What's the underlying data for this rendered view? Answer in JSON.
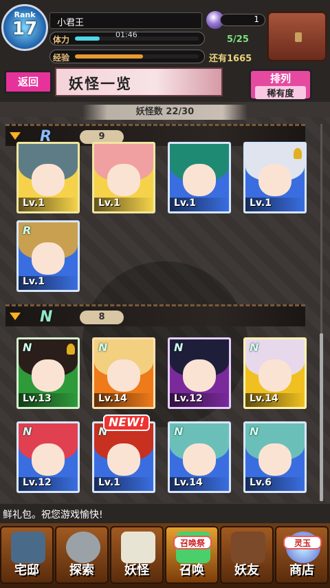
{
  "player": {
    "rank_label": "Rank",
    "rank": "17",
    "name": "小君王",
    "stamina_label": "体力",
    "timer": "01:46",
    "stamina": "5/25",
    "stamina_fill": 0.2,
    "exp_label": "经验",
    "exp_fill": 0.55,
    "coins_label": "还有1665",
    "orbs": "1"
  },
  "header": {
    "back_label": "返回",
    "title": "妖怪一览",
    "sort_line1": "排列",
    "sort_line2": "稀有度"
  },
  "count_label": "妖怪数  22/30",
  "sections": [
    {
      "rarity": "R",
      "count": "9"
    },
    {
      "rarity": "N",
      "count": "8"
    }
  ],
  "cards_r": [
    {
      "level": "Lv.1",
      "rk": ""
    },
    {
      "level": "Lv.1",
      "rk": ""
    },
    {
      "level": "Lv.1",
      "rk": ""
    },
    {
      "level": "Lv.1",
      "rk": ""
    },
    {
      "level": "Lv.1",
      "rk": "R"
    }
  ],
  "cards_n": [
    {
      "level": "Lv.13",
      "rk": "N"
    },
    {
      "level": "Lv.14",
      "rk": "N"
    },
    {
      "level": "Lv.12",
      "rk": "N"
    },
    {
      "level": "Lv.14",
      "rk": "N"
    },
    {
      "level": "Lv.12",
      "rk": "N"
    },
    {
      "level": "Lv.1",
      "rk": "N"
    },
    {
      "level": "Lv.14",
      "rk": "N"
    },
    {
      "level": "Lv.6",
      "rk": "N"
    }
  ],
  "new_badge": "NEW!",
  "ticker": "鲜礼包。祝您游戏愉快!",
  "nav": [
    {
      "label": "宅邸",
      "icon": "mansion-icon"
    },
    {
      "label": "探索",
      "icon": "magnifier-icon"
    },
    {
      "label": "妖怪",
      "icon": "scroll-icon"
    },
    {
      "label": "召唤",
      "icon": "summon-icon",
      "bubble": "召唤祭"
    },
    {
      "label": "妖友",
      "icon": "friend-icon"
    },
    {
      "label": "商店",
      "icon": "shop-orb-icon",
      "bubble": "灵玉"
    }
  ]
}
